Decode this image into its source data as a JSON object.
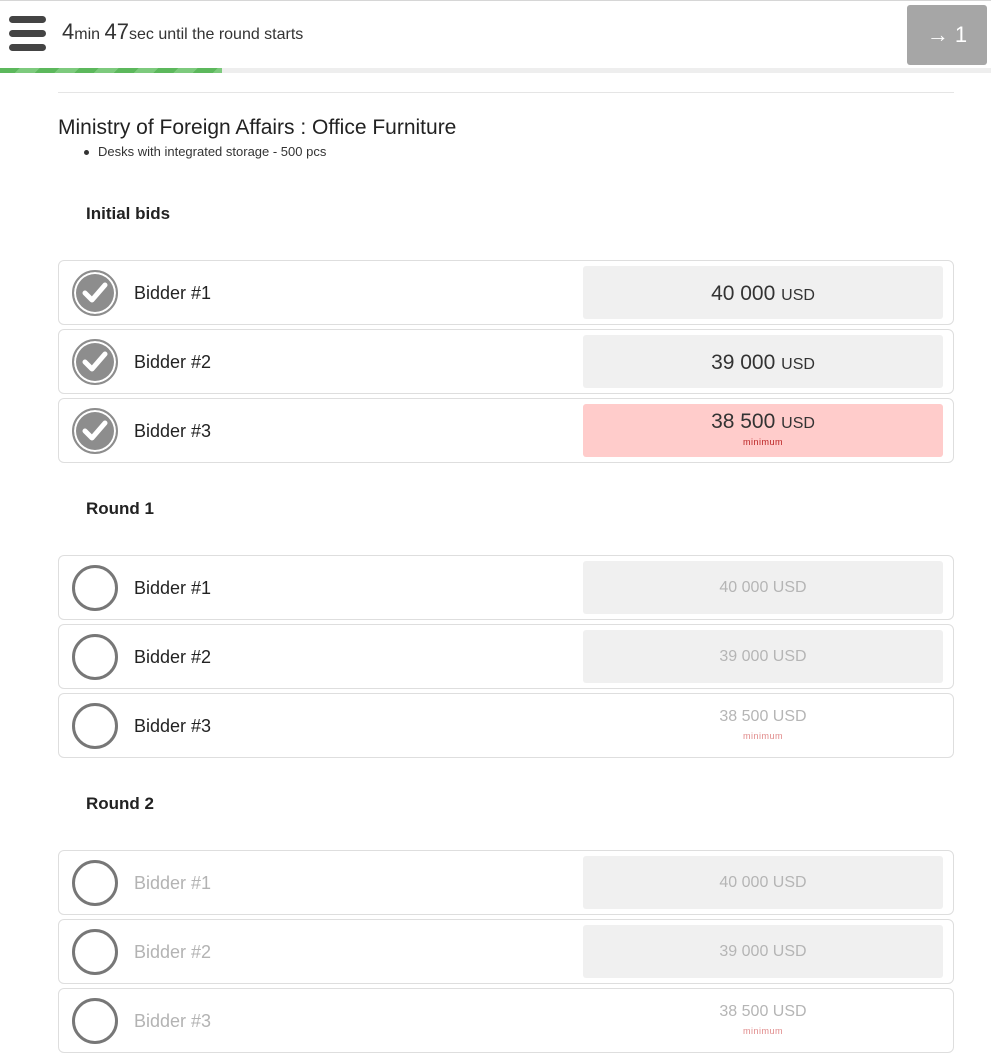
{
  "header": {
    "timer_minutes": "4",
    "timer_min_unit": "min",
    "timer_seconds": "47",
    "timer_sec_unit": "sec",
    "timer_text": "until the round starts",
    "round_button_label": "→ 1",
    "progress_fraction": 0.224,
    "progress_color": "#5cb85c",
    "menu_icon": "hamburger-menu-icon"
  },
  "tender": {
    "title": "Ministry of Foreign Affairs : Office Furniture",
    "items": [
      "Desks with integrated storage - 500 pcs"
    ]
  },
  "currency": "USD",
  "minimum_label": "minimum",
  "sections": [
    {
      "title": "Initial bids",
      "rows": [
        {
          "bidder": "Bidder #1",
          "amount": "40 000",
          "checked": true
        },
        {
          "bidder": "Bidder #2",
          "amount": "39 000",
          "checked": true
        },
        {
          "bidder": "Bidder #3",
          "amount": "38 500",
          "checked": true,
          "minimum": true
        }
      ]
    },
    {
      "title": "Round 1",
      "rows": [
        {
          "bidder": "Bidder #1",
          "amount": "40 000 USD",
          "checked": false
        },
        {
          "bidder": "Bidder #2",
          "amount": "39 000 USD",
          "checked": false
        },
        {
          "bidder": "Bidder #3",
          "amount": "38 500 USD",
          "checked": false,
          "minimum": true
        }
      ]
    },
    {
      "title": "Round 2",
      "rows": [
        {
          "bidder": "Bidder #1",
          "amount": "40 000 USD",
          "checked": false
        },
        {
          "bidder": "Bidder #2",
          "amount": "39 000 USD",
          "checked": false
        },
        {
          "bidder": "Bidder #3",
          "amount": "38 500 USD",
          "checked": false,
          "minimum": true
        }
      ]
    }
  ]
}
